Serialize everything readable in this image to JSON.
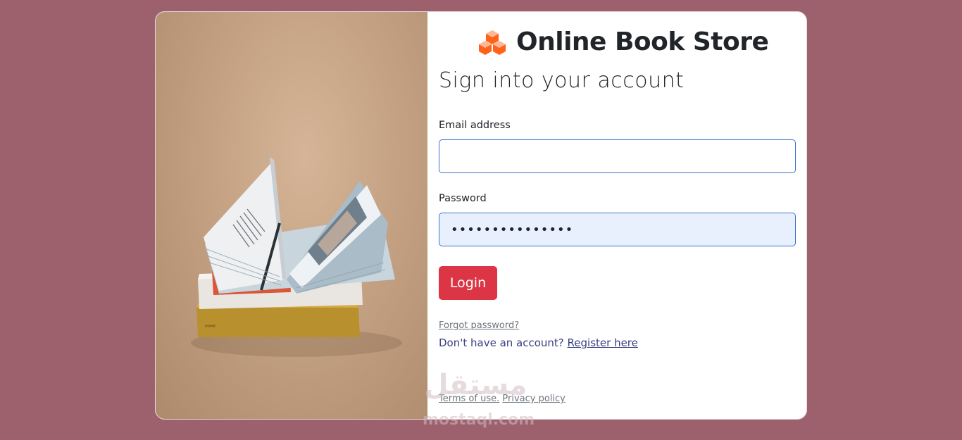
{
  "brand": {
    "title": "Online Book Store",
    "icon": "cubes-icon",
    "icon_color": "#ff6219"
  },
  "form": {
    "heading": "Sign into your account",
    "email_label": "Email address",
    "email_value": "",
    "password_label": "Password",
    "password_value": "•••••••••••••••",
    "login_label": "Login",
    "forgot_label": "Forgot password?",
    "register_prompt": "Don't have an account? ",
    "register_link": "Register here"
  },
  "footer": {
    "terms": "Terms of use.",
    "privacy": "Privacy policy"
  },
  "watermark": {
    "arabic": "مستقل",
    "latin": "mostaql.com"
  },
  "colors": {
    "background": "#9c616c",
    "login_button": "#dc3545",
    "link": "#393f81"
  }
}
